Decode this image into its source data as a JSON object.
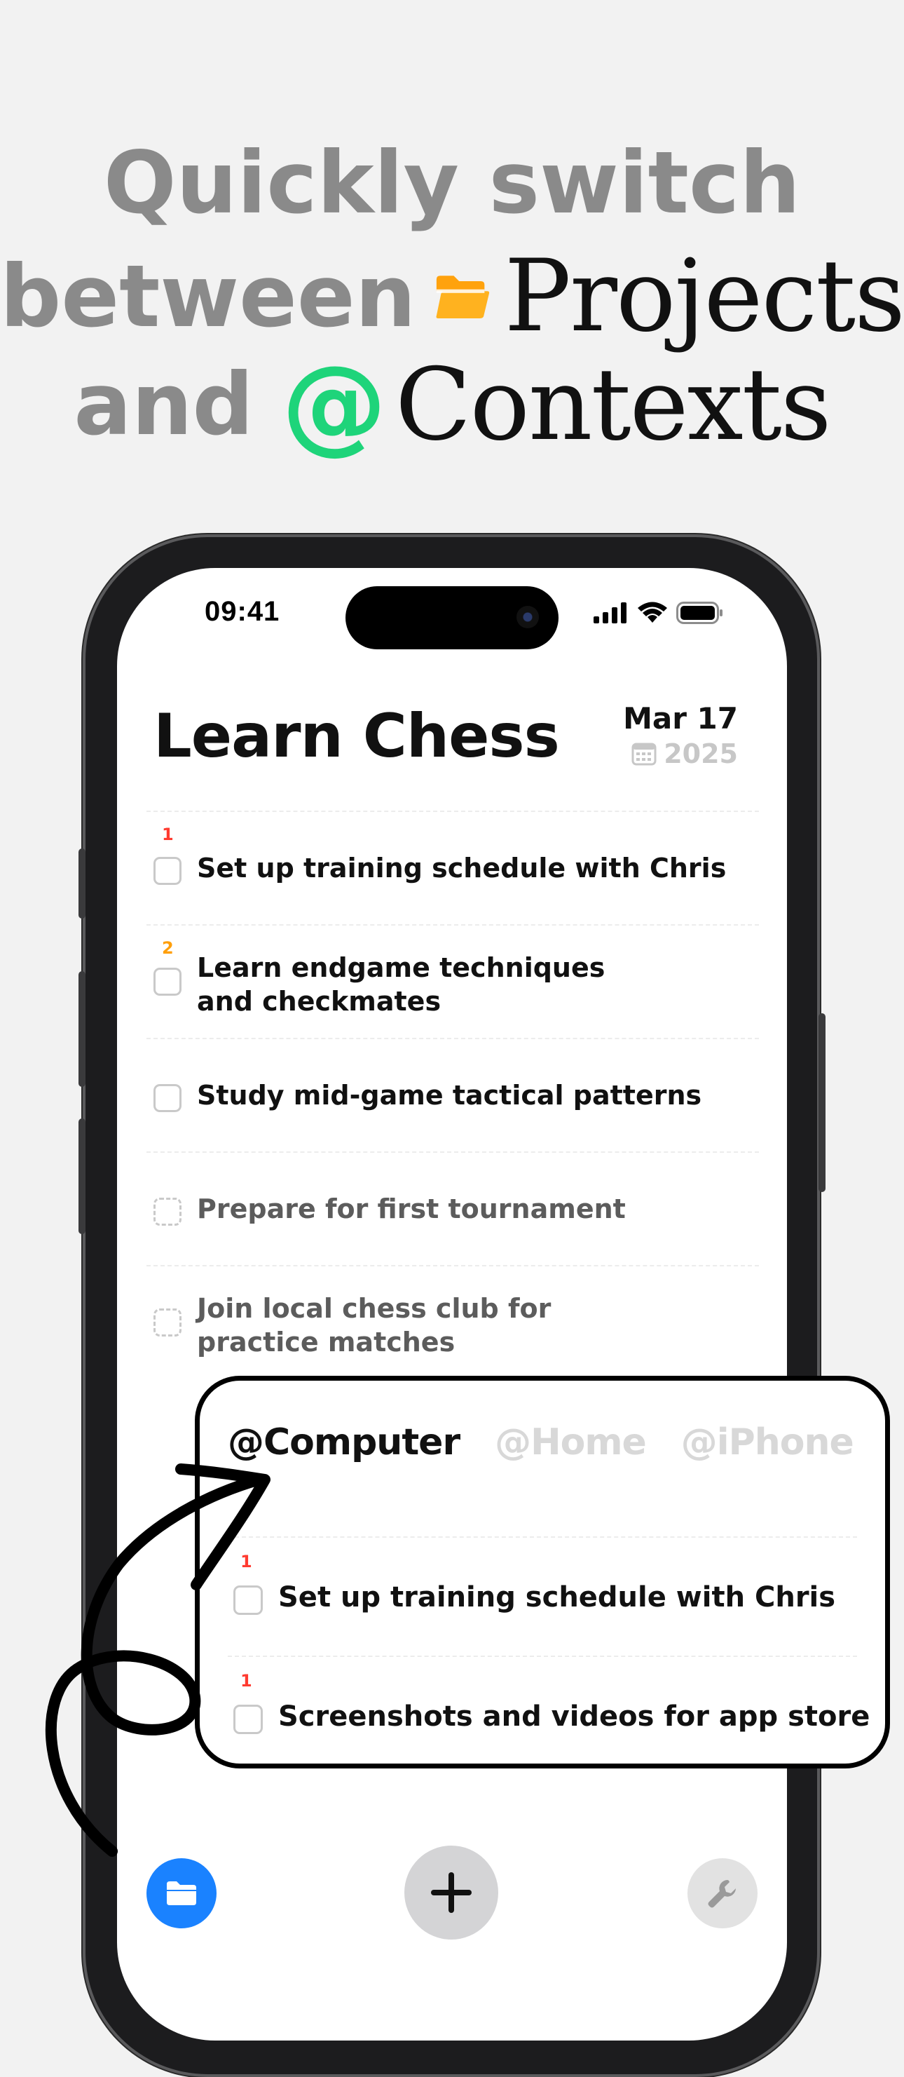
{
  "headline": {
    "line1": "Quickly switch",
    "line2_prefix": "between",
    "line2_word": "Projects",
    "line3_prefix": "and",
    "line3_symbol": "@",
    "line3_word": "Contexts"
  },
  "colors": {
    "folder": "#ffa20d",
    "at_symbol": "#1ed47a",
    "priority_1": "#ff3b30",
    "priority_2": "#ff9f0a",
    "accent_blue": "#1a82ff"
  },
  "status_bar": {
    "time": "09:41",
    "icons": [
      "cellular-signal-icon",
      "wifi-icon",
      "battery-icon"
    ]
  },
  "project": {
    "title": "Learn Chess",
    "date": "Mar 17",
    "year": "2025"
  },
  "tasks": [
    {
      "priority": "1",
      "label": "Set up training schedule with Chris",
      "state": "open"
    },
    {
      "priority": "2",
      "label": "Learn endgame techniques\nand checkmates",
      "state": "open"
    },
    {
      "priority": "",
      "label": "Study mid-game tactical patterns",
      "state": "open"
    },
    {
      "priority": "",
      "label": "Prepare for first tournament",
      "state": "someday"
    },
    {
      "priority": "",
      "label": "Join local chess club for\npractice matches",
      "state": "someday"
    }
  ],
  "contexts": {
    "tabs": [
      "@Computer",
      "@Home",
      "@iPhone",
      "@"
    ],
    "active": "@Computer",
    "tasks": [
      {
        "priority": "1",
        "label": "Set up training schedule with Chris"
      },
      {
        "priority": "1",
        "label": "Screenshots and videos for app store"
      }
    ]
  },
  "bottom_bar": {
    "left_icon": "folder-icon",
    "center_icon": "plus-icon",
    "right_icon": "wrench-icon"
  }
}
